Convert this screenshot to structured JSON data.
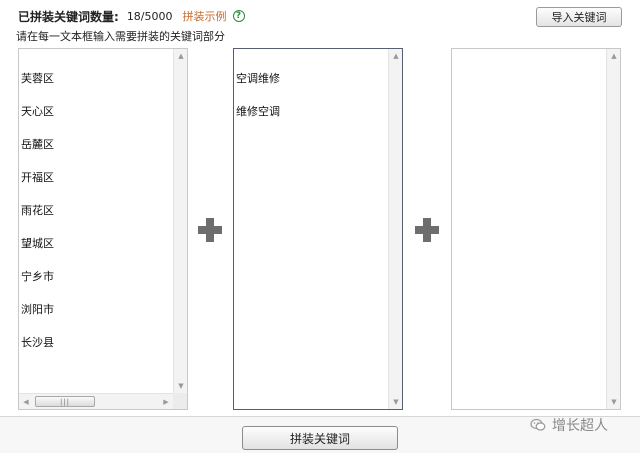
{
  "header": {
    "count_label": "已拼装关键词数量:",
    "count_value": "18/5000",
    "example_link": "拼装示例",
    "help_icon": "?"
  },
  "import_button": "导入关键词",
  "instruction": "请在每一文本框输入需要拼装的关键词部分",
  "boxes": [
    {
      "lines": [
        "芙蓉区",
        "天心区",
        "岳麓区",
        "开福区",
        "雨花区",
        "望城区",
        "宁乡市",
        "浏阳市",
        "长沙县"
      ]
    },
    {
      "lines": [
        "空调维修",
        "维修空调"
      ]
    },
    {
      "lines": []
    }
  ],
  "combine_button": "拼装关键词",
  "watermark": "增长超人",
  "icons": {
    "plus": "plus-icon",
    "help": "help-circle-icon",
    "watermark": "wechat-logo-icon"
  }
}
